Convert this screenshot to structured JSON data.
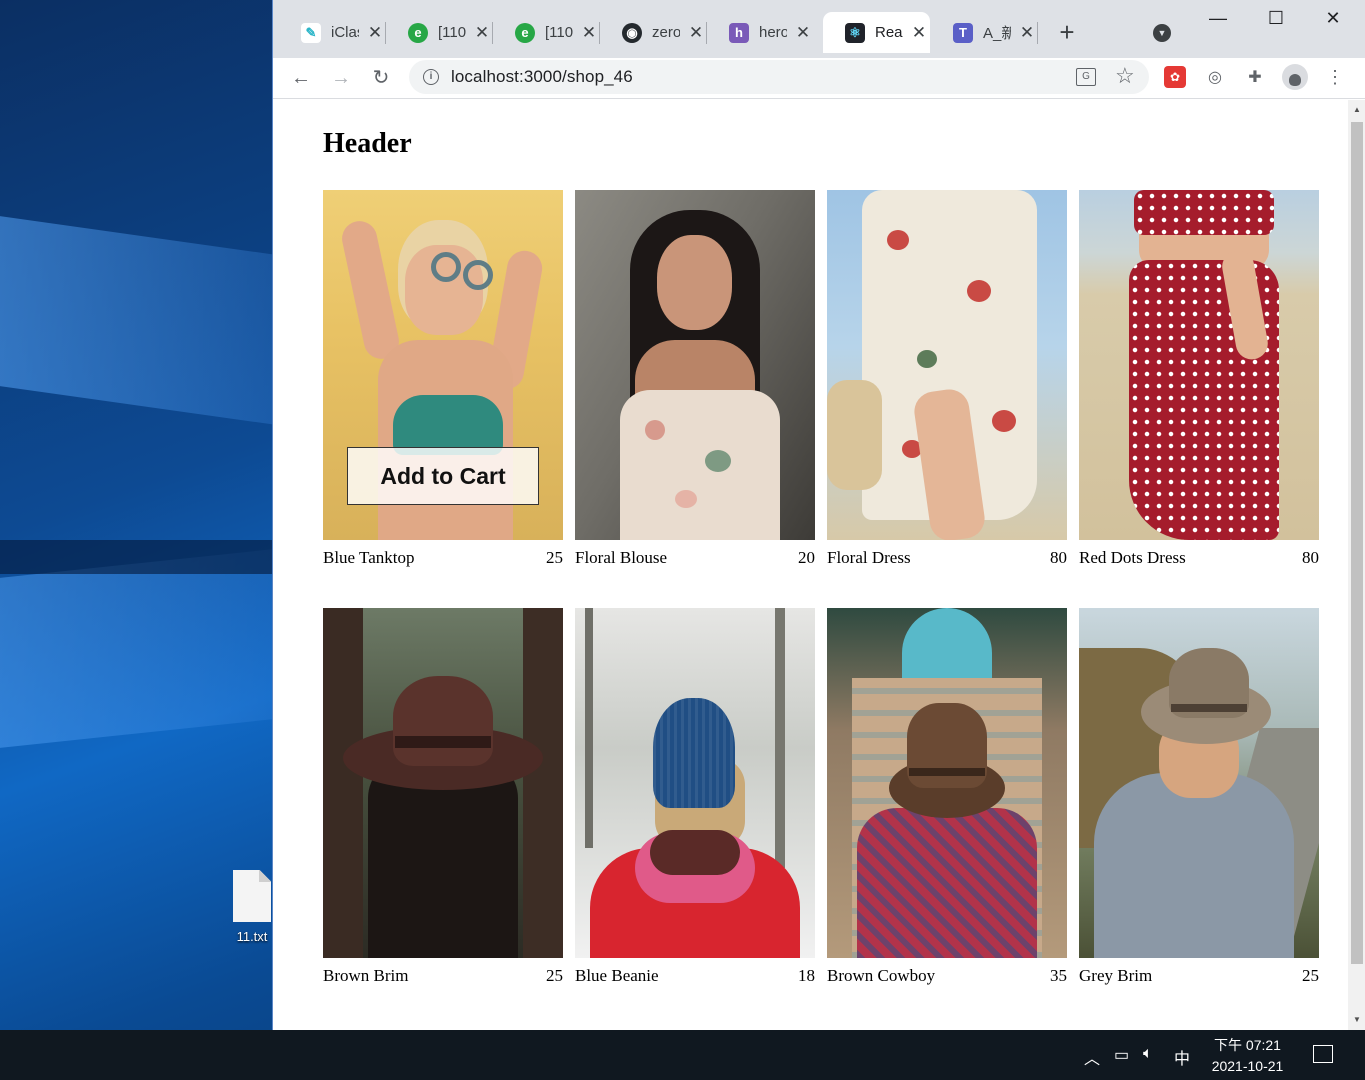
{
  "desktop": {
    "file_label": "11.txt"
  },
  "browser": {
    "tabs": [
      {
        "title": "iClas",
        "icon": "iclass-icon",
        "color": "#2bb5c8"
      },
      {
        "title": "[110",
        "icon": "evernote-icon",
        "color": "#27a746"
      },
      {
        "title": "[110",
        "icon": "evernote-icon",
        "color": "#27a746"
      },
      {
        "title": "zero",
        "icon": "github-icon",
        "color": "#24292e"
      },
      {
        "title": "hero",
        "icon": "heroku-icon",
        "color": "#7a5ab8"
      },
      {
        "title": "Rea",
        "icon": "react-icon",
        "color": "#20232a",
        "active": true
      },
      {
        "title": "A_新",
        "icon": "teams-icon",
        "color": "#5a5fc7"
      }
    ],
    "new_tab": "+",
    "url": "localhost:3000/shop_46"
  },
  "page": {
    "header": "Header",
    "add_to_cart_label": "Add to Cart",
    "products": [
      {
        "name": "Blue Tanktop",
        "price": "25"
      },
      {
        "name": "Floral Blouse",
        "price": "20"
      },
      {
        "name": "Floral Dress",
        "price": "80"
      },
      {
        "name": "Red Dots Dress",
        "price": "80"
      },
      {
        "name": "Brown Brim",
        "price": "25"
      },
      {
        "name": "Blue Beanie",
        "price": "18"
      },
      {
        "name": "Brown Cowboy",
        "price": "35"
      },
      {
        "name": "Grey Brim",
        "price": "25"
      }
    ]
  },
  "taskbar": {
    "ime": "中",
    "time": "下午 07:21",
    "date": "2021-10-21"
  }
}
